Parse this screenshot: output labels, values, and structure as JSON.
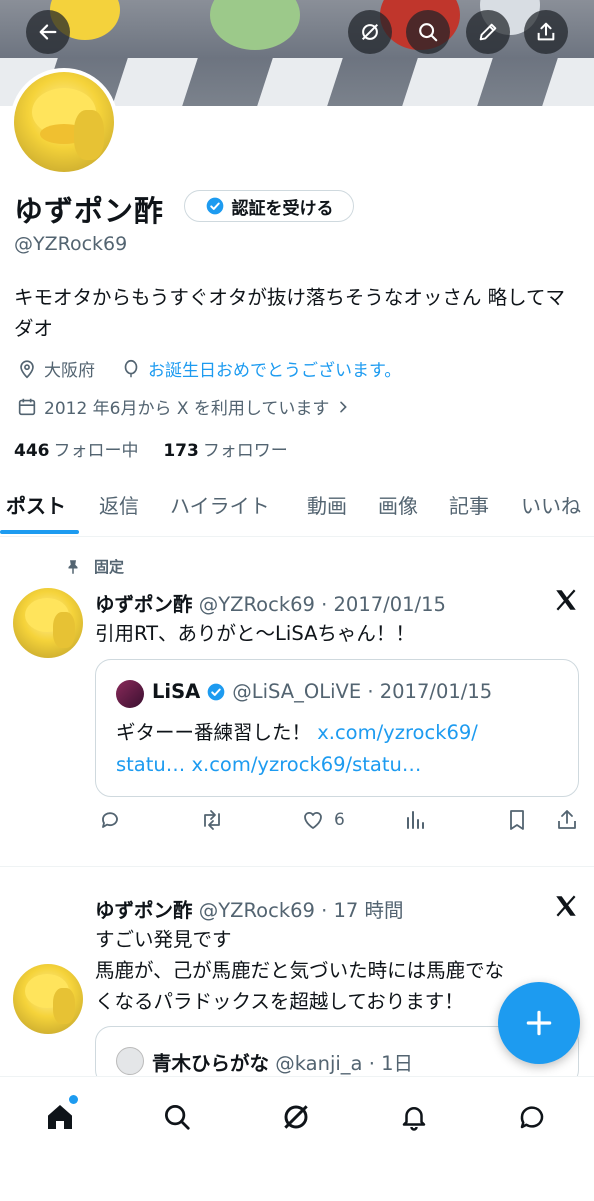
{
  "header": {
    "back_icon": "arrow-left-icon",
    "grok_icon": "grok-icon",
    "search_icon": "search-icon",
    "edit_icon": "pen-icon",
    "share_icon": "share-icon"
  },
  "profile": {
    "name": "ゆずポン酢",
    "verify_label": "認証を受ける",
    "handle": "@YZRock69",
    "bio": "キモオタからもうすぐオタが抜け落ちそうなオッさん 略してマダオ",
    "location": "大阪府",
    "birthday": "お誕生日おめでとうございます。",
    "joined": "2012 年6月から X を利用しています",
    "following_count": "446",
    "following_label": "フォロー中",
    "followers_count": "173",
    "followers_label": "フォロワー"
  },
  "tabs": [
    "ポスト",
    "返信",
    "ハイライト",
    "動画",
    "画像",
    "記事",
    "いいね"
  ],
  "pinned_label": "固定",
  "posts": [
    {
      "name": "ゆずポン酢",
      "meta": "@YZRock69 · 2017/01/15",
      "text": "引用RT、ありがと〜LiSAちゃん！！",
      "quote": {
        "name": "LiSA",
        "meta": "@LiSA_OLiVE · 2017/01/15",
        "text": "ギターー番練習した！",
        "link1": "x.com/yzrock69/",
        "link2": "statu…",
        "link3": "x.com/yzrock69/statu…"
      },
      "likes": "6"
    },
    {
      "name": "ゆずポン酢",
      "meta": "@YZRock69 · 17 時間",
      "line1": "すごい発見です",
      "line2": "馬鹿が、己が馬鹿だと気づいた時には馬鹿でな",
      "line3": "くなるパラドックスを超越しております！",
      "quote": {
        "name": "青木ひらがな",
        "meta": "@kanji_a · 1日"
      }
    }
  ],
  "colors": {
    "accent": "#1d9bf0",
    "muted": "#536471",
    "text": "#0f1419"
  }
}
